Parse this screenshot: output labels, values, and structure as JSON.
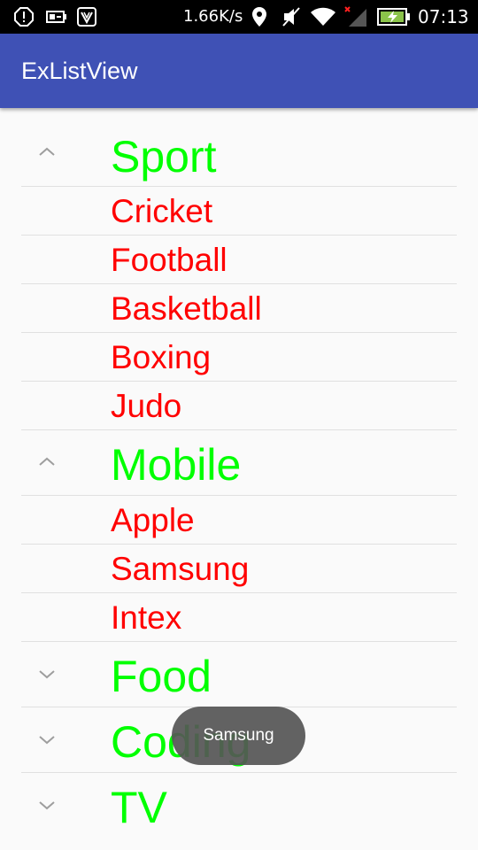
{
  "status_bar": {
    "speed": "1.66K/s",
    "time": "07:13",
    "icons": [
      "alert-icon",
      "battery-saver-icon",
      "launcher-app-icon",
      "location-icon",
      "mute-icon",
      "wifi-icon",
      "no-signal-icon",
      "battery-charging-icon"
    ]
  },
  "app_bar": {
    "title": "ExListView"
  },
  "groups": [
    {
      "label": "Sport",
      "expanded": true,
      "children": [
        "Cricket",
        "Football",
        "Basketball",
        "Boxing",
        "Judo"
      ]
    },
    {
      "label": "Mobile",
      "expanded": true,
      "children": [
        "Apple",
        "Samsung",
        "Intex"
      ]
    },
    {
      "label": "Food",
      "expanded": false,
      "children": []
    },
    {
      "label": "Coding",
      "expanded": false,
      "children": []
    },
    {
      "label": "TV",
      "expanded": false,
      "children": []
    }
  ],
  "toast": {
    "text": "Samsung"
  },
  "colors": {
    "app_bar": "#3f51b5",
    "group_text": "#00ff00",
    "child_text": "#ff0000",
    "background": "#fafafa"
  }
}
